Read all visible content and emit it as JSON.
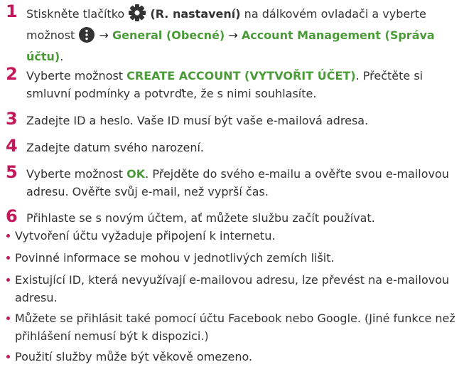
{
  "steps": [
    {
      "number": "1",
      "t1": "Stiskněte tlačítko",
      "settings_label": "(R. nastavení)",
      "t2": "na dálkovém ovladači a vyberte možnost",
      "arrow": "→",
      "general": "General (Obecné)",
      "account_mgmt": "Account Management (Správa účtu)",
      "end": "."
    },
    {
      "number": "2",
      "t1": "Vyberte možnost",
      "create": "CREATE ACCOUNT (VYTVOŘIT ÚČET)",
      "t2": ". Přečtěte si smluvní podmínky a potvrďte, že s nimi souhlasíte."
    },
    {
      "number": "3",
      "text": "Zadejte ID a heslo. Vaše ID musí být vaše e-mailová adresa."
    },
    {
      "number": "4",
      "text": "Zadejte datum svého narození."
    },
    {
      "number": "5",
      "t1": "Vyberte možnost",
      "ok": "OK",
      "t2": ". Přejděte do svého e-mailu a ověřte svou e-mailovou adresu. Ověřte svůj e-mail, než vyprší čas."
    },
    {
      "number": "6",
      "text": "Přihlaste se s novým účtem, ať můžete službu začít používat."
    }
  ],
  "notes": [
    "Vytvoření účtu vyžaduje připojení k internetu.",
    "Povinné informace se mohou v jednotlivých zemích lišit.",
    "Existující ID, která nevyužívají e-mailovou adresu, lze převést na e-mailovou adresu.",
    "Můžete se přihlásit také pomocí účtu Facebook nebo Google. (Jiné funkce než přihlášení nemusí být k dispozici.)",
    "Použití služby může být věkově omezeno."
  ],
  "colors": {
    "step_number": "#c2185b",
    "highlight": "#4a9b38",
    "bullet": "#c2185b"
  },
  "icons": [
    "gear-icon",
    "more-options-icon"
  ]
}
